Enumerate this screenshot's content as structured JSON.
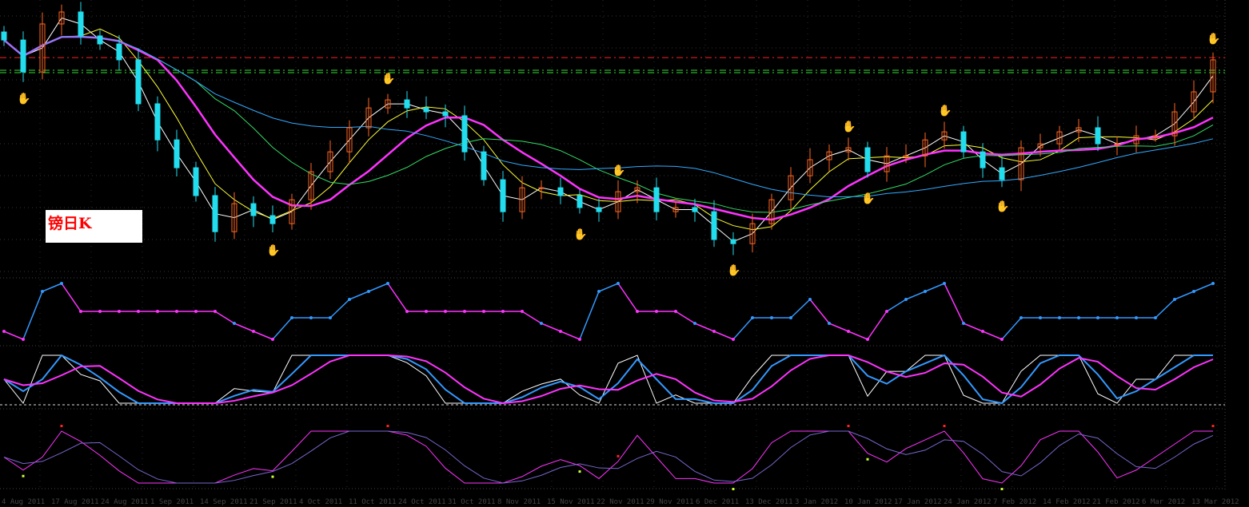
{
  "chart_data": {
    "type": "candlestick",
    "title": "镑日K",
    "instrument_label": "镑日K",
    "ylim": [
      1.5136,
      1.6747
    ],
    "closes": [
      1.6513,
      1.6326,
      1.6607,
      1.6677,
      1.6537,
      1.649,
      1.6397,
      1.614,
      1.5929,
      1.5766,
      1.5603,
      1.5392,
      1.5556,
      1.5486,
      1.5439,
      1.5579,
      1.5743,
      1.5859,
      1.6,
      1.6116,
      1.6163,
      1.6116,
      1.6093,
      1.607,
      1.5859,
      1.5696,
      1.5509,
      1.5649,
      1.5649,
      1.5603,
      1.5533,
      1.5509,
      1.5626,
      1.5649,
      1.5509,
      1.5533,
      1.5509,
      1.5346,
      1.5322,
      1.5439,
      1.5579,
      1.5719,
      1.5813,
      1.5859,
      1.5883,
      1.5743,
      1.5836,
      1.5836,
      1.5929,
      1.5976,
      1.5859,
      1.5766,
      1.5696,
      1.5883,
      1.5906,
      1.5976,
      1.6,
      1.5906,
      1.5906,
      1.5953,
      1.5953,
      1.6093,
      1.621,
      1.6397
    ],
    "first_open": 1.656,
    "moving_averages": [
      {
        "name": "MA5",
        "period": 2,
        "color": "#ffffff"
      },
      {
        "name": "MA10",
        "period": 4,
        "color": "#ffff33"
      },
      {
        "name": "MA20",
        "period": 7,
        "color": "#ff33ff"
      },
      {
        "name": "MA30",
        "period": 11,
        "color": "#33dd66"
      },
      {
        "name": "MA60",
        "period": 20,
        "color": "#33aaff"
      }
    ],
    "horizontal_levels": [
      {
        "value": 1.641,
        "color": "#ff2222"
      },
      {
        "value": 1.6336,
        "color": "#33dd33"
      },
      {
        "value": 1.6322,
        "color": "#33dd33"
      }
    ],
    "top_signals": [
      3,
      20,
      32,
      44,
      49,
      63
    ],
    "bottom_signals": [
      1,
      14,
      30,
      38,
      45,
      52
    ],
    "x_tick_labels": [
      "4 Aug 2011",
      "17 Aug 2011",
      "24 Aug 2011",
      "1 Sep 2011",
      "14 Sep 2011",
      "21 Sep 2011",
      "4 Oct 2011",
      "11 Oct 2011",
      "24 Oct 2011",
      "31 Oct 2011",
      "8 Nov 2011",
      "15 Nov 2011",
      "22 Nov 2011",
      "29 Nov 2011",
      "6 Dec 2011",
      "13 Dec 2011",
      "3 Jan 2012",
      "10 Jan 2012",
      "17 Jan 2012",
      "24 Jan 2012",
      "7 Feb 2012",
      "14 Feb 2012",
      "21 Feb 2012",
      "6 Mar 2012",
      "13 Mar 2012"
    ],
    "colors": {
      "up": "#ff6622",
      "down": "#22ddee",
      "background": "#000000",
      "grid": "#333333"
    }
  }
}
